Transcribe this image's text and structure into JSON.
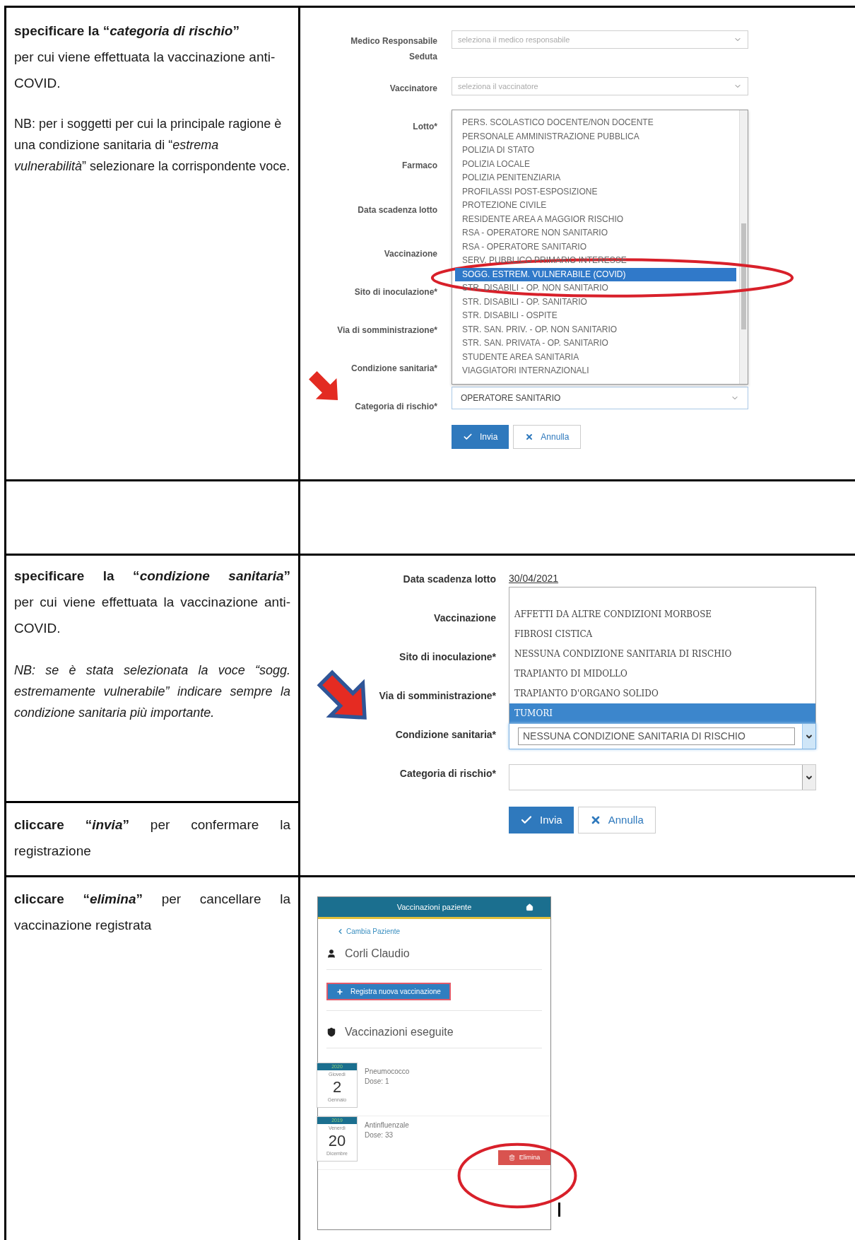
{
  "risk_step": {
    "heading": "specificare la “*categoria di rischio*”",
    "body": "per cui viene effettuata la vaccinazione anti-COVID.",
    "note": "NB: per i soggetti per cui la principale ragione è una condizione sanitaria di “*estrema vulnerabilità*” selezionare la corrispondente voce."
  },
  "risk_form": {
    "fields": [
      {
        "label": "Medico Responsabile Seduta",
        "placeholder": "seleziona il medico responsabile"
      },
      {
        "label": "Vaccinatore",
        "placeholder": "seleziona il vaccinatore"
      }
    ],
    "labels": [
      "Lotto*",
      "Farmaco",
      "Data scadenza lotto",
      "Vaccinazione",
      "Sito di inoculazione*",
      "Via di somministrazione*",
      "Condizione sanitaria*",
      "Categoria di rischio*"
    ],
    "options": [
      {
        "text": "PERS. SCOLASTICO DOCENTE/NON DOCENTE",
        "selected": false
      },
      {
        "text": "PERSONALE AMMINISTRAZIONE PUBBLICA",
        "selected": false
      },
      {
        "text": "POLIZIA DI STATO",
        "selected": false
      },
      {
        "text": "POLIZIA LOCALE",
        "selected": false
      },
      {
        "text": "POLIZIA PENITENZIARIA",
        "selected": false
      },
      {
        "text": "PROFILASSI POST-ESPOSIZIONE",
        "selected": false
      },
      {
        "text": "PROTEZIONE CIVILE",
        "selected": false
      },
      {
        "text": "RESIDENTE AREA A MAGGIOR RISCHIO",
        "selected": false
      },
      {
        "text": "RSA - OPERATORE NON SANITARIO",
        "selected": false
      },
      {
        "text": "RSA - OPERATORE SANITARIO",
        "selected": false
      },
      {
        "text": "SERV. PUBBLICO PRIMARIO INTERESSE",
        "selected": false
      },
      {
        "text": "SOGG. ESTREM. VULNERABILE (COVID)",
        "selected": true
      },
      {
        "text": "STR. DISABILI - OP. NON SANITARIO",
        "selected": false
      },
      {
        "text": "STR. DISABILI - OP. SANITARIO",
        "selected": false
      },
      {
        "text": "STR. DISABILI - OSPITE",
        "selected": false
      },
      {
        "text": "STR. SAN. PRIV. - OP. NON SANITARIO",
        "selected": false
      },
      {
        "text": "STR. SAN. PRIVATA - OP. SANITARIO",
        "selected": false
      },
      {
        "text": "STUDENTE AREA SANITARIA",
        "selected": false
      },
      {
        "text": "VIAGGIATORI INTERNAZIONALI",
        "selected": false
      }
    ],
    "value": "OPERATORE SANITARIO",
    "buttons": [
      {
        "label": "Invia",
        "kind": "primary"
      },
      {
        "label": "Annulla",
        "kind": "cancel"
      }
    ]
  },
  "condition_step": {
    "heading": "specificare la “*condizione sanitaria*”",
    "body": "per cui viene effettuata la vaccinazione anti-COVID.",
    "note": "NB: se è stata selezionata la voce “sogg. estremamente vulnerabile” indicare sempre la condizione sanitaria più importante."
  },
  "confirm_step": {
    "text": "**cliccare “*invia*”** per confermare la registrazione"
  },
  "condition_form": {
    "expiry": {
      "label": "Data scadenza lotto",
      "value": "30/04/2021"
    },
    "labels": [
      "Vaccinazione",
      "Sito di inoculazione*",
      "Via di somministrazione*"
    ],
    "options": [
      {
        "text": "AFFETTI DA ALTRE CONDIZIONI MORBOSE",
        "selected": false
      },
      {
        "text": "FIBROSI CISTICA",
        "selected": false
      },
      {
        "text": "NESSUNA CONDIZIONE SANITARIA DI RISCHIO",
        "selected": false
      },
      {
        "text": "TRAPIANTO DI MIDOLLO",
        "selected": false
      },
      {
        "text": "TRAPIANTO D'ORGANO SOLIDO",
        "selected": false
      },
      {
        "text": "TUMORI",
        "selected": true
      }
    ],
    "condition": {
      "label": "Condizione sanitaria*",
      "value": "NESSUNA CONDIZIONE SANITARIA DI RISCHIO"
    },
    "risk": {
      "label": "Categoria di rischio*"
    },
    "buttons": [
      {
        "label": "Invia",
        "kind": "primary"
      },
      {
        "label": "Annulla",
        "kind": "cancel"
      }
    ]
  },
  "delete_step": {
    "text": "**cliccare “*elimina*”** per cancellare la vaccinazione registrata"
  },
  "patient_panel": {
    "title": "Vaccinazioni paziente",
    "back_link": "Cambia Paziente",
    "patient": "Corli Claudio",
    "new_button": "Registra nuova vaccinazione",
    "section": "Vaccinazioni eseguite",
    "vaccinations": [
      {
        "year": "2020",
        "weekday": "Giovedì",
        "day": "2",
        "month": "Gennaio",
        "name": "Pneumococco",
        "dose": "Dose: 1"
      },
      {
        "year": "2019",
        "weekday": "Venerdì",
        "day": "20",
        "month": "Dicembre",
        "name": "Antinfluenzale",
        "dose": "Dose: 33",
        "action": "Elimina"
      }
    ]
  }
}
